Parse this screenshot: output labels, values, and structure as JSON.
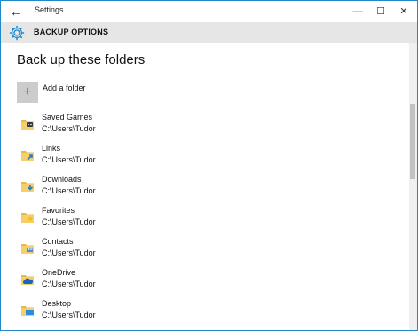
{
  "window": {
    "title": "Settings"
  },
  "header": {
    "title": "BACKUP OPTIONS",
    "icon": "gear-icon",
    "accent": "#1e88c8"
  },
  "main": {
    "heading": "Back up these folders",
    "add_folder_label": "Add a folder",
    "folders": [
      {
        "name": "Saved Games",
        "path": "C:\\Users\\Tudor",
        "icon": "saved-games-folder-icon"
      },
      {
        "name": "Links",
        "path": "C:\\Users\\Tudor",
        "icon": "links-folder-icon"
      },
      {
        "name": "Downloads",
        "path": "C:\\Users\\Tudor",
        "icon": "downloads-folder-icon"
      },
      {
        "name": "Favorites",
        "path": "C:\\Users\\Tudor",
        "icon": "favorites-folder-icon"
      },
      {
        "name": "Contacts",
        "path": "C:\\Users\\Tudor",
        "icon": "contacts-folder-icon"
      },
      {
        "name": "OneDrive",
        "path": "C:\\Users\\Tudor",
        "icon": "onedrive-folder-icon"
      },
      {
        "name": "Desktop",
        "path": "C:\\Users\\Tudor",
        "icon": "desktop-folder-icon"
      }
    ]
  }
}
